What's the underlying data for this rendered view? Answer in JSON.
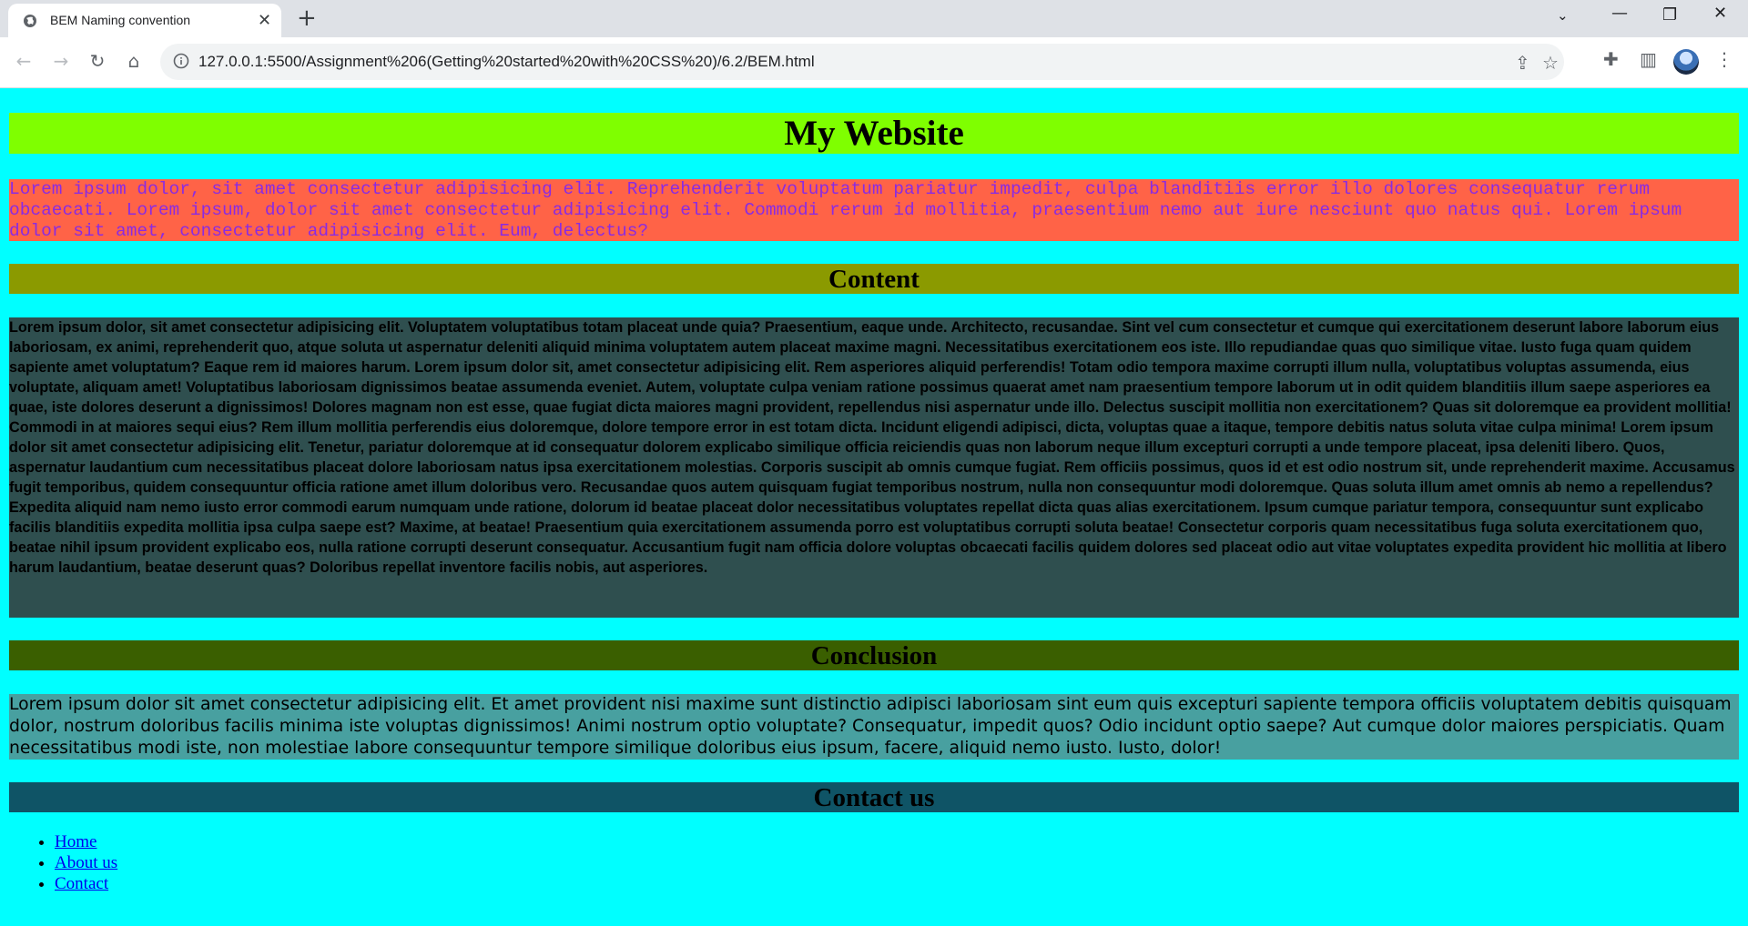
{
  "browser": {
    "tab_title": "BEM Naming convention",
    "url": "127.0.0.1:5500/Assignment%206(Getting%20started%20with%20CSS%20)/6.2/BEM.html"
  },
  "page": {
    "site_title": "My Website",
    "intro_text": "Lorem ipsum dolor, sit amet consectetur adipisicing elit. Reprehenderit voluptatum pariatur impedit, culpa blanditiis error illo dolores consequatur rerum obcaecati. Lorem ipsum, dolor sit amet consectetur adipisicing elit. Commodi rerum id mollitia, praesentium nemo aut iure nesciunt quo natus qui. Lorem ipsum dolor sit amet, consectetur adipisicing elit. Eum, delectus?",
    "content_heading": "Content",
    "content_text": "Lorem ipsum dolor, sit amet consectetur adipisicing elit. Voluptatem voluptatibus totam placeat unde quia? Praesentium, eaque unde. Architecto, recusandae. Sint vel cum consectetur et cumque qui exercitationem deserunt labore laborum eius laboriosam, ex animi, reprehenderit quo, atque soluta ut aspernatur deleniti aliquid minima voluptatem autem placeat maxime magni. Necessitatibus exercitationem eos iste. Illo repudiandae quas quo similique vitae. Iusto fuga quam quidem sapiente amet voluptatum? Eaque rem id maiores harum. Lorem ipsum dolor sit, amet consectetur adipisicing elit. Rem asperiores aliquid perferendis! Totam odio tempora maxime corrupti illum nulla, voluptatibus voluptas assumenda, eius voluptate, aliquam amet! Voluptatibus laboriosam dignissimos beatae assumenda eveniet. Autem, voluptate culpa veniam ratione possimus quaerat amet nam praesentium tempore laborum ut in odit quidem blanditiis illum saepe asperiores ea quae, iste dolores deserunt a dignissimos! Dolores magnam non est esse, quae fugiat dicta maiores magni provident, repellendus nisi aspernatur unde illo. Delectus suscipit mollitia non exercitationem? Quas sit doloremque ea provident mollitia! Commodi in at maiores sequi eius? Rem illum mollitia perferendis eius doloremque, dolore tempore error in est totam dicta. Incidunt eligendi adipisci, dicta, voluptas quae a itaque, tempore debitis natus soluta vitae culpa minima! Lorem ipsum dolor sit amet consectetur adipisicing elit. Tenetur, pariatur doloremque at id consequatur dolorem explicabo similique officia reiciendis quas non laborum neque illum excepturi corrupti a unde tempore placeat, ipsa deleniti libero. Quos, aspernatur laudantium cum necessitatibus placeat dolore laboriosam natus ipsa exercitationem molestias. Corporis suscipit ab omnis cumque fugiat. Rem officiis possimus, quos id et est odio nostrum sit, unde reprehenderit maxime. Accusamus fugit temporibus, quidem consequuntur officia ratione amet illum doloribus vero. Recusandae quos autem quisquam fugiat temporibus nostrum, nulla non consequuntur modi doloremque. Quas soluta illum amet omnis ab nemo a repellendus? Expedita aliquid nam nemo iusto error commodi earum numquam unde ratione, dolorum id beatae placeat dolor necessitatibus voluptates repellat dicta quas alias exercitationem. Ipsum cumque pariatur tempora, consequuntur sunt explicabo facilis blanditiis expedita mollitia ipsa culpa saepe est? Maxime, at beatae! Praesentium quia exercitationem assumenda porro est voluptatibus corrupti soluta beatae! Consectetur corporis quam necessitatibus fuga soluta exercitationem quo, beatae nihil ipsum provident explicabo eos, nulla ratione corrupti deserunt consequatur. Accusantium fugit nam officia dolore voluptas obcaecati facilis quidem dolores sed placeat odio aut vitae voluptates expedita provident hic mollitia at libero harum laudantium, beatae deserunt quas? Doloribus repellat inventore facilis nobis, aut asperiores.",
    "conclusion_heading": "Conclusion",
    "conclusion_text": "Lorem ipsum dolor sit amet consectetur adipisicing elit. Et amet provident nisi maxime sunt distinctio adipisci laboriosam sint eum quis excepturi sapiente tempora officiis voluptatem debitis quisquam dolor, nostrum doloribus facilis minima iste voluptas dignissimos! Animi nostrum optio voluptate? Consequatur, impedit quos? Odio incidunt optio saepe? Aut cumque dolor maiores perspiciatis. Quam necessitatibus modi iste, non molestiae labore consequuntur tempore similique doloribus eius ipsum, facere, aliquid nemo iusto. Iusto, dolor!",
    "contact_heading": "Contact us",
    "contact_links": [
      "Home",
      "About us",
      "Contact"
    ]
  },
  "colors": {
    "page_background": "#00ffff",
    "title_background": "#7fff00",
    "intro_background": "#ff6347",
    "intro_text": "#8a2be2",
    "content_heading_background": "#8b9a00",
    "content_background": "#2f4f4f",
    "conclusion_heading_background": "#3a5f00",
    "conclusion_background": "#48a0a0",
    "contact_heading_background": "#0f5466",
    "link": "#0000ee"
  },
  "icons": [
    "globe-icon",
    "close-icon",
    "plus-icon",
    "back-arrow-icon",
    "forward-arrow-icon",
    "reload-icon",
    "home-icon",
    "info-icon",
    "share-icon",
    "star-icon",
    "extensions-icon",
    "side-panel-icon",
    "more-icon"
  ]
}
